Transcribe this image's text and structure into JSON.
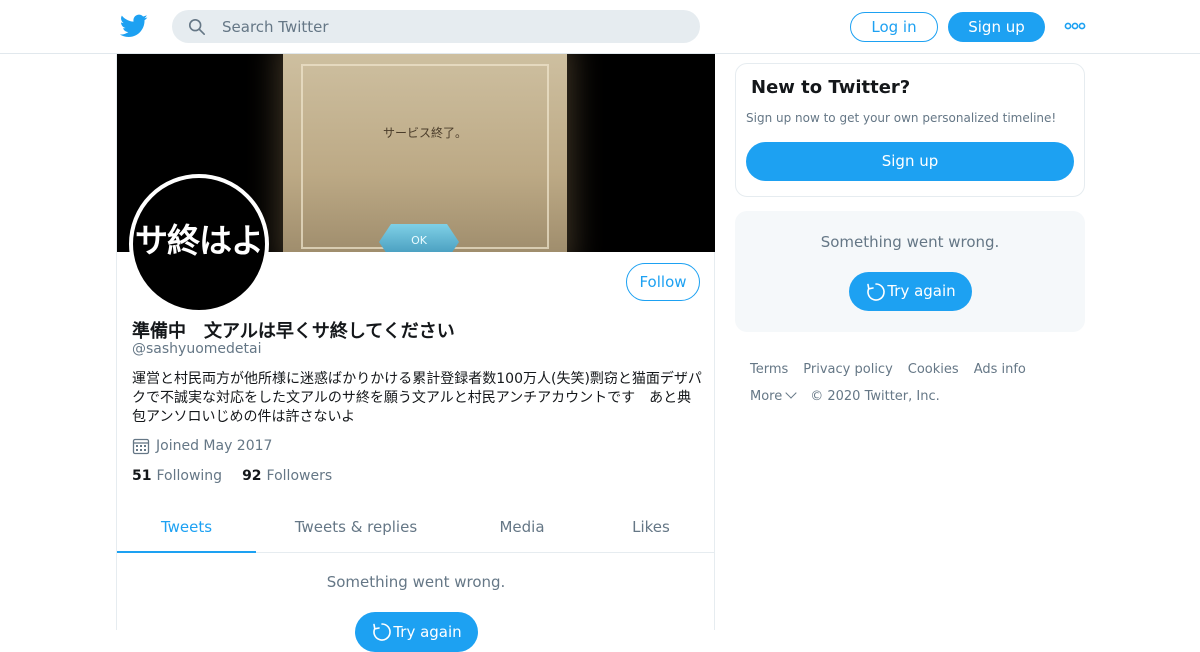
{
  "header": {
    "search_placeholder": "Search Twitter",
    "login_label": "Log in",
    "signup_label": "Sign up"
  },
  "banner": {
    "text": "サービス終了。",
    "ok_label": "OK"
  },
  "profile": {
    "avatar_text": "サ終はよ",
    "display_name": "準備中　文アルは早くサ終してください",
    "handle": "@sashyuomedetai",
    "bio": "運営と村民両方が他所様に迷惑ばかりかける累計登録者数100万人(失笑)剽窃と猫面デザパクで不誠実な対応をした文アルのサ終を願う文アルと村民アンチアカウントです　あと典包アンソロいじめの件は許さないよ",
    "joined": "Joined May 2017",
    "following_count": "51",
    "following_label": "Following",
    "followers_count": "92",
    "followers_label": "Followers",
    "follow_label": "Follow"
  },
  "tabs": [
    {
      "label": "Tweets",
      "active": true
    },
    {
      "label": "Tweets & replies",
      "active": false
    },
    {
      "label": "Media",
      "active": false
    },
    {
      "label": "Likes",
      "active": false
    }
  ],
  "timeline": {
    "error": "Something went wrong.",
    "try_again": "Try again"
  },
  "sidebar": {
    "new_title": "New to Twitter?",
    "new_subtitle": "Sign up now to get your own personalized timeline!",
    "signup_label": "Sign up",
    "error": "Something went wrong.",
    "try_again": "Try again"
  },
  "footer": {
    "links": [
      "Terms",
      "Privacy policy",
      "Cookies",
      "Ads info"
    ],
    "more": "More",
    "copyright": "© 2020 Twitter, Inc."
  },
  "colors": {
    "accent": "#1da1f2",
    "muted": "#657786"
  }
}
